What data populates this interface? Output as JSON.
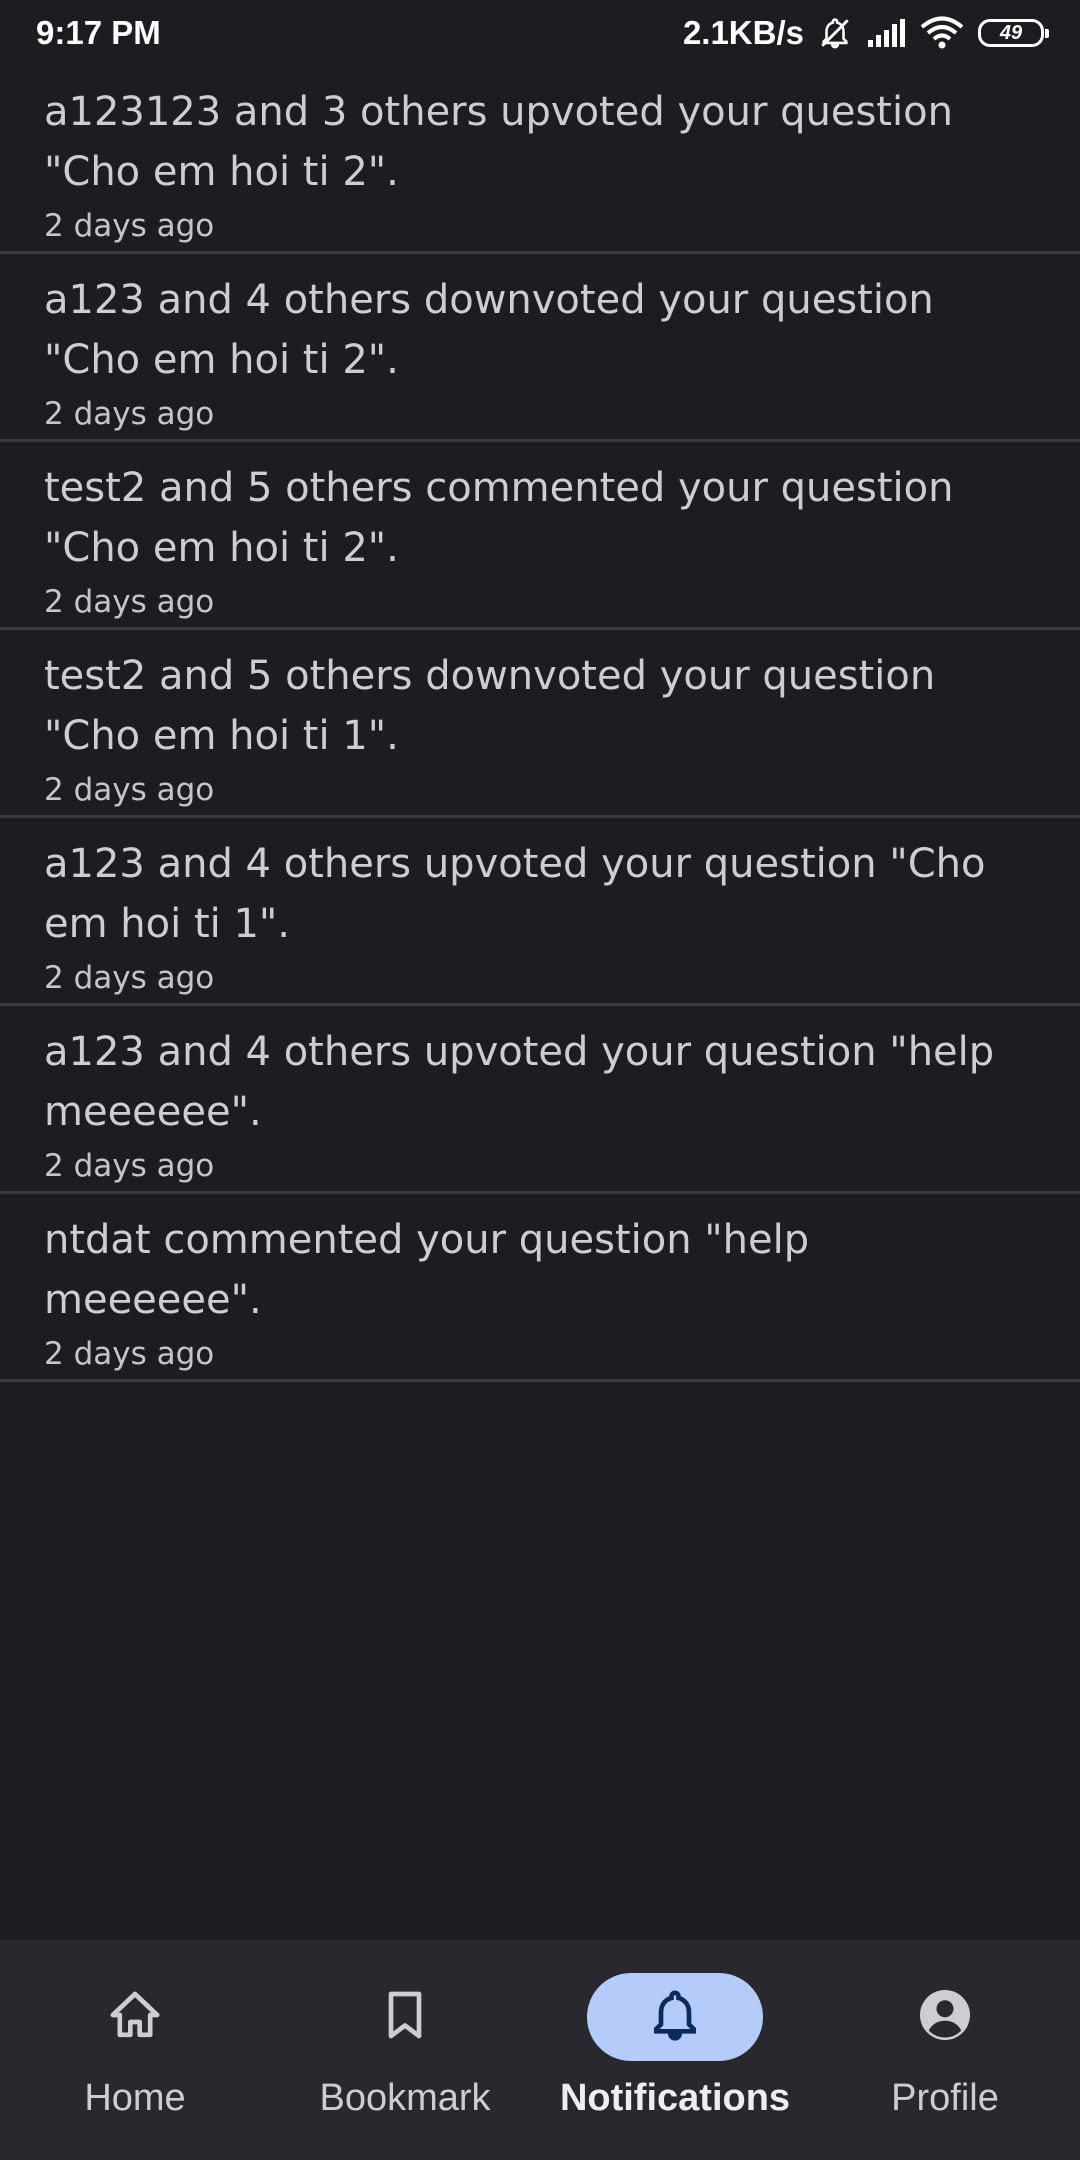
{
  "status_bar": {
    "time": "9:17 PM",
    "network_speed": "2.1KB/s",
    "battery_level": "49",
    "icons": [
      "bell-muted-icon",
      "signal-icon",
      "wifi-icon",
      "battery-icon"
    ]
  },
  "notifications": [
    {
      "text": "a123123 and 3 others upvoted your question \"Cho em hoi ti 2\".",
      "time": "2 days ago"
    },
    {
      "text": "a123 and 4 others downvoted your question \"Cho em hoi ti 2\".",
      "time": "2 days ago"
    },
    {
      "text": "test2 and 5 others commented your question \"Cho em hoi ti 2\".",
      "time": "2 days ago"
    },
    {
      "text": "test2 and 5 others downvoted your question \"Cho em hoi ti 1\".",
      "time": "2 days ago"
    },
    {
      "text": "a123 and 4 others upvoted your question \"Cho em hoi ti 1\".",
      "time": "2 days ago"
    },
    {
      "text": "a123 and 4 others upvoted your question \"help meeeeee\".",
      "time": "2 days ago"
    },
    {
      "text": "ntdat commented your question \"help meeeeee\".",
      "time": "2 days ago"
    }
  ],
  "bottom_nav": {
    "items": [
      {
        "label": "Home",
        "icon": "home-icon",
        "active": false
      },
      {
        "label": "Bookmark",
        "icon": "bookmark-icon",
        "active": false
      },
      {
        "label": "Notifications",
        "icon": "bell-icon",
        "active": true
      },
      {
        "label": "Profile",
        "icon": "account-circle-icon",
        "active": false
      }
    ]
  },
  "colors": {
    "background": "#1d1c21",
    "nav_background": "#29282f",
    "active_pill": "#b5ccfb",
    "active_icon": "#0d2a5c",
    "divider": "#3a393f"
  }
}
